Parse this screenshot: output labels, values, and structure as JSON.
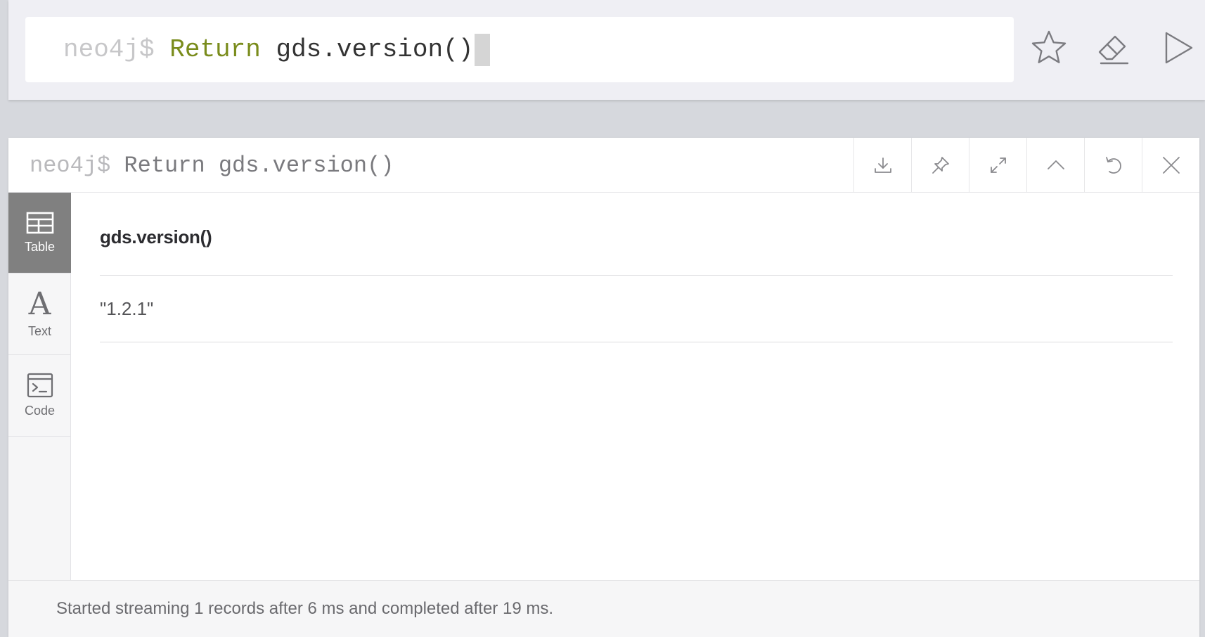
{
  "editor": {
    "prompt": "neo4j$ ",
    "keyword": "Return",
    "query_rest": " gds.version()",
    "actions": [
      "favorite-icon",
      "clear-icon",
      "run-icon"
    ]
  },
  "frame": {
    "title_prompt": "neo4j$ ",
    "title_query": "Return gds.version()",
    "actions": [
      "download-icon",
      "pin-icon",
      "fullscreen-icon",
      "collapse-icon",
      "rerun-icon",
      "close-icon"
    ]
  },
  "sidebar": {
    "tabs": [
      {
        "label": "Table",
        "icon": "table-icon",
        "active": true
      },
      {
        "label": "Text",
        "icon": "text-icon",
        "glyph": "A",
        "active": false
      },
      {
        "label": "Code",
        "icon": "code-icon",
        "active": false
      }
    ]
  },
  "table": {
    "columns": [
      "gds.version()"
    ],
    "rows": [
      [
        "\"1.2.1\""
      ]
    ]
  },
  "footer": {
    "status": "Started streaming 1 records after 6 ms and completed after 19 ms."
  },
  "colors": {
    "keyword": "#7a8c1c",
    "active_tab": "#808080"
  }
}
